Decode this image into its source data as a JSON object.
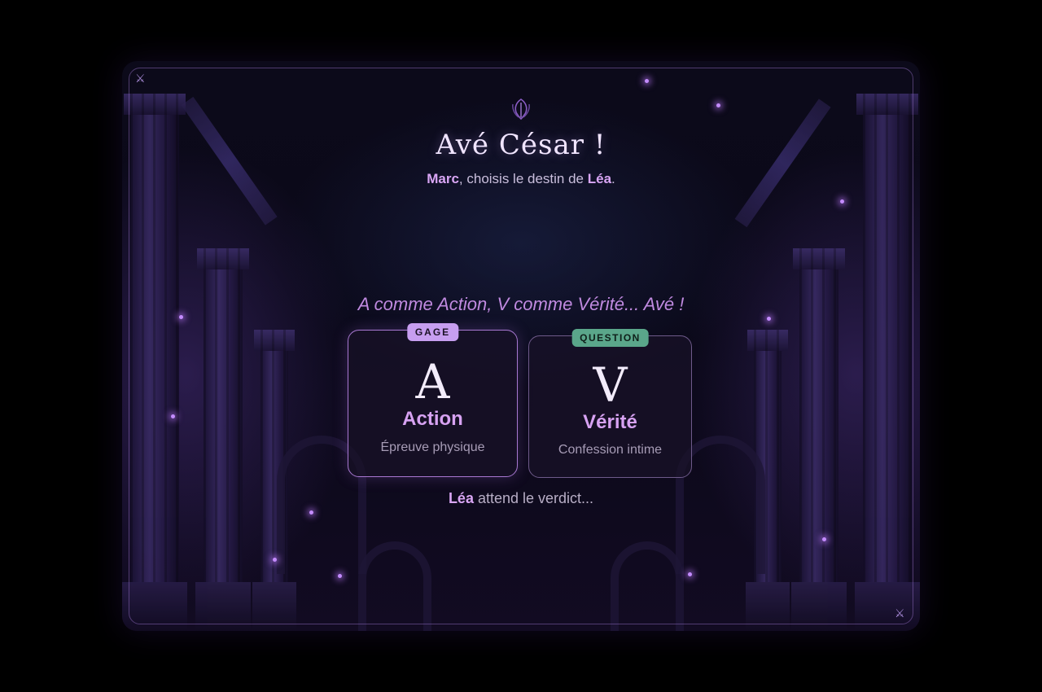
{
  "header": {
    "title": "Avé César !",
    "subtitle": {
      "chooser": "Marc",
      "middle": ", choisis le destin de ",
      "target": "Léa",
      "end": "."
    }
  },
  "tagline": "A comme Action, V comme Vérité... Avé !",
  "choices": {
    "action": {
      "badge": "GAGE",
      "letter": "A",
      "label": "Action",
      "description": "Épreuve physique"
    },
    "verite": {
      "badge": "QUESTION",
      "letter": "V",
      "label": "Vérité",
      "description": "Confession intime"
    }
  },
  "status": {
    "player": "Léa",
    "text": " attend le verdict..."
  },
  "icons": {
    "emblem": "laurel-emblem-icon",
    "corner_top_left": "crossed-swords-icon",
    "corner_bottom_right": "crossed-swords-icon"
  },
  "colors": {
    "accent": "#d9a6f5",
    "gage_badge": "#c79ef0",
    "question_badge": "#5aa68a",
    "background": "#0a0818"
  }
}
